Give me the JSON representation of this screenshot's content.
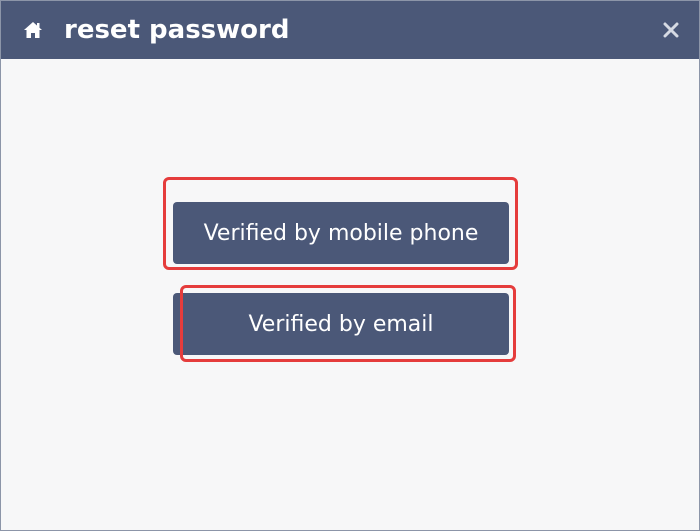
{
  "window": {
    "title": "reset password",
    "home_icon": "home-icon",
    "close_icon": "close-icon"
  },
  "options": {
    "mobile_label": "Verified by mobile phone",
    "email_label": "Verified by email"
  },
  "colors": {
    "titlebar": "#4b5878",
    "button": "#4b5878",
    "highlight": "#e53c3c",
    "background": "#f7f7f8"
  }
}
